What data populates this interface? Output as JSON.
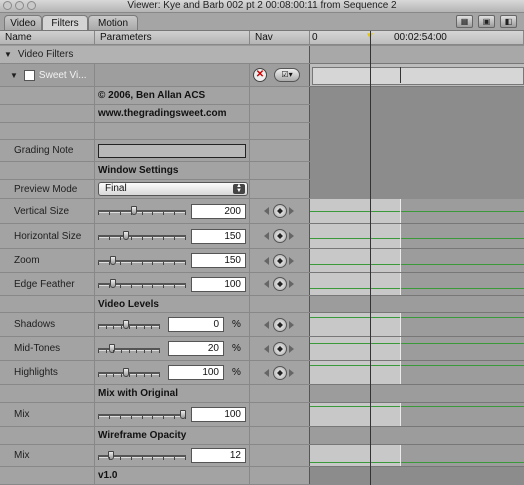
{
  "window": {
    "title": "Viewer: Kye and Barb 002 pt 2 00:08:00:11 from Sequence 2"
  },
  "tabs": [
    {
      "label": "Video"
    },
    {
      "label": "Filters"
    },
    {
      "label": "Motion"
    }
  ],
  "columns": {
    "name": "Name",
    "parameters": "Parameters",
    "nav": "Nav"
  },
  "timeline": {
    "ruler_start": "0",
    "ruler_time": "00:02:54:00"
  },
  "tree": {
    "video_filters": "Video Filters",
    "filter_name": "Sweet Vi..."
  },
  "info": {
    "copyright": "© 2006, Ben Allan ACS",
    "website": "www.thegradingsweet.com"
  },
  "grading_note": {
    "label": "Grading Note",
    "value": ""
  },
  "sections": {
    "window_settings": "Window Settings",
    "video_levels": "Video Levels",
    "mix_with_original": "Mix with Original",
    "wireframe_opacity": "Wireframe Opacity",
    "version": "v1.0"
  },
  "preview_mode": {
    "label": "Preview Mode",
    "value": "Final"
  },
  "params": {
    "vertical_size": {
      "label": "Vertical Size",
      "value": "200",
      "level": 0.4
    },
    "horizontal_size": {
      "label": "Horizontal Size",
      "value": "150",
      "level": 0.3
    },
    "zoom": {
      "label": "Zoom",
      "value": "150",
      "level": 0.15
    },
    "edge_feather": {
      "label": "Edge Feather",
      "value": "100",
      "level": 0.15
    },
    "shadows": {
      "label": "Shadows",
      "value": "0",
      "unit": "%",
      "level": 0.45
    },
    "midtones": {
      "label": "Mid-Tones",
      "value": "20",
      "unit": "%",
      "level": 0.2
    },
    "highlights": {
      "label": "Highlights",
      "value": "100",
      "unit": "%",
      "level": 0.45
    },
    "mix1": {
      "label": "Mix",
      "value": "100",
      "level": 1.0
    },
    "mix2": {
      "label": "Mix",
      "value": "12",
      "level": 0.12
    }
  }
}
